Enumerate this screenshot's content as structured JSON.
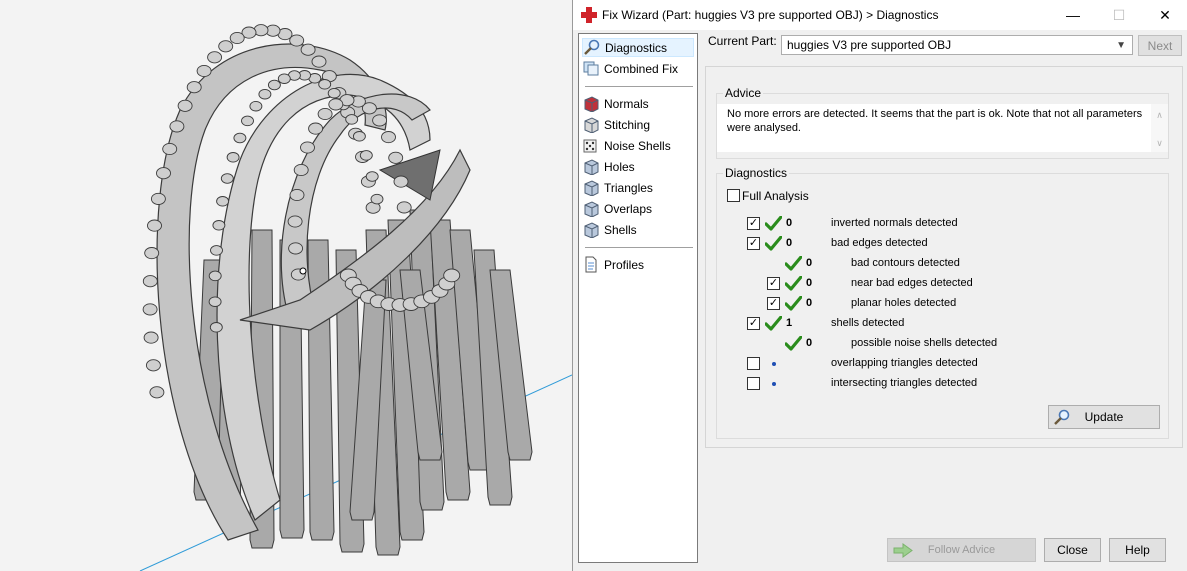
{
  "window": {
    "title": "Fix Wizard (Part: huggies V3 pre supported OBJ) > Diagnostics",
    "minimize_glyph": "—",
    "maximize_glyph": "☐",
    "close_glyph": "✕"
  },
  "nav": {
    "groups": [
      [
        {
          "label": "Diagnostics",
          "icon": "magnifier-icon",
          "selected": true
        },
        {
          "label": "Combined Fix",
          "icon": "layers-icon"
        }
      ],
      [
        {
          "label": "Normals",
          "icon": "cube-normals-icon"
        },
        {
          "label": "Stitching",
          "icon": "cube-stitching-icon"
        },
        {
          "label": "Noise Shells",
          "icon": "dice-icon"
        },
        {
          "label": "Holes",
          "icon": "cube-holes-icon"
        },
        {
          "label": "Triangles",
          "icon": "cube-triangles-icon"
        },
        {
          "label": "Overlaps",
          "icon": "cube-overlaps-icon"
        },
        {
          "label": "Shells",
          "icon": "cube-shells-icon"
        }
      ],
      [
        {
          "label": "Profiles",
          "icon": "document-icon"
        }
      ]
    ]
  },
  "part": {
    "label": "Current Part:",
    "value": "huggies V3 pre supported OBJ",
    "next_label": "Next"
  },
  "advice": {
    "title": "Advice",
    "text": "No more errors are detected. It seems that the part is ok. Note that not all parameters were analysed.",
    "scroll_up": "∧",
    "scroll_down": "∨"
  },
  "diagnostics": {
    "title": "Diagnostics",
    "full_analysis_label": "Full Analysis",
    "full_analysis_checked": false,
    "rows": [
      {
        "checkbox": "checked",
        "status": "ok",
        "count": "0",
        "label": "inverted normals detected",
        "indent": 0
      },
      {
        "checkbox": "checked",
        "status": "ok",
        "count": "0",
        "label": "bad edges detected",
        "indent": 0
      },
      {
        "checkbox": "none",
        "status": "ok",
        "count": "0",
        "label": "bad contours detected",
        "indent": 1
      },
      {
        "checkbox": "checked",
        "status": "ok",
        "count": "0",
        "label": "near bad edges detected",
        "indent": 1
      },
      {
        "checkbox": "checked",
        "status": "ok",
        "count": "0",
        "label": "planar holes detected",
        "indent": 1
      },
      {
        "checkbox": "checked",
        "status": "ok",
        "count": "1",
        "label": "shells detected",
        "indent": 0
      },
      {
        "checkbox": "none",
        "status": "ok",
        "count": "0",
        "label": "possible noise shells detected",
        "indent": 1
      },
      {
        "checkbox": "unchecked",
        "status": "pending",
        "count": "",
        "label": "overlapping triangles detected",
        "indent": 0
      },
      {
        "checkbox": "unchecked",
        "status": "pending",
        "count": "",
        "label": "intersecting triangles detected",
        "indent": 0
      }
    ],
    "update_label": "Update",
    "check_glyph": "✓"
  },
  "buttons": {
    "follow_advice": "Follow Advice",
    "close": "Close",
    "help": "Help"
  },
  "colors": {
    "ok_tick": "#2a8c1c",
    "pending_dot": "#1f4fb4",
    "app_icon": "#d0232a",
    "model_fill": "#c4c4c4",
    "axis_line": "#2f9bd8"
  }
}
